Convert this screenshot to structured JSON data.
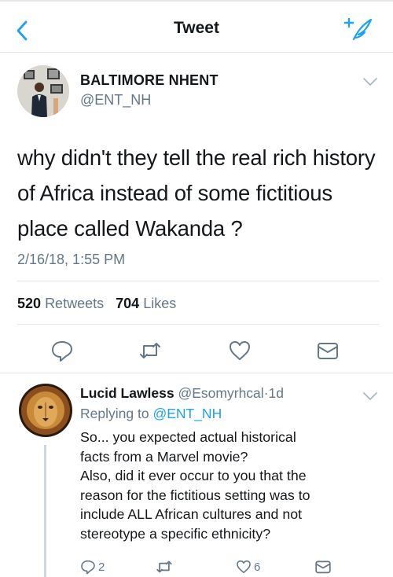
{
  "header": {
    "title": "Tweet"
  },
  "tweet": {
    "author_name": "BALTIMORE NHENT",
    "author_handle": "@ENT_NH",
    "text_lines": [
      "why didn't they tell the real rich history",
      "of Africa instead of some fictitious",
      "place called Wakanda ?"
    ],
    "timestamp": "2/16/18, 1:55 PM",
    "retweets_count": "520",
    "retweets_label": "Retweets",
    "likes_count": "704",
    "likes_label": "Likes"
  },
  "reply": {
    "author_name": "Lucid Lawless",
    "author_handle": "@Esomyrhcal",
    "separator": "·",
    "time": "1d",
    "replying_prefix": "Replying to",
    "replying_handle": "@ENT_NH",
    "text_lines": [
      "So... you expected actual historical",
      "facts from a Marvel movie?",
      "Also, did it ever occur to you that the",
      "reason for the fictitious setting was to",
      "include ALL African cultures and not",
      "stereotype a specific ethnicity?"
    ],
    "reply_count": "2",
    "like_count": "6"
  },
  "colors": {
    "accent": "#1da1f2",
    "muted": "#657786",
    "text": "#14171a",
    "divider": "#e1e8ed"
  },
  "icons": [
    "back-chevron-icon",
    "compose-tweet-icon",
    "reply-icon",
    "retweet-icon",
    "like-heart-icon",
    "direct-message-icon",
    "chevron-down-icon"
  ]
}
